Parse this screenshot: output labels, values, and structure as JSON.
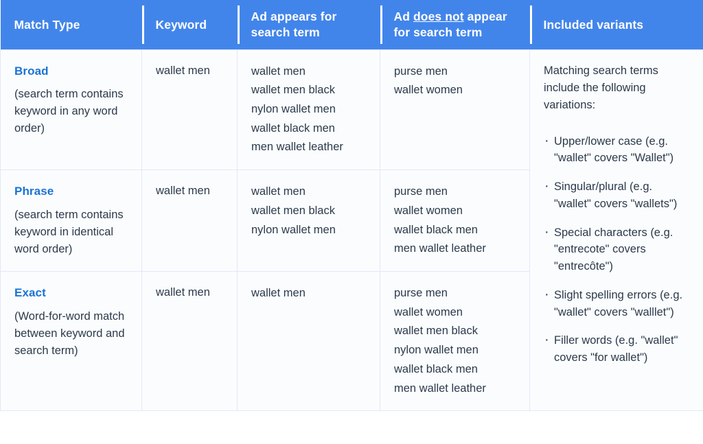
{
  "table": {
    "headers": [
      {
        "id": "match-type",
        "label": "Match Type"
      },
      {
        "id": "keyword",
        "label": "Keyword"
      },
      {
        "id": "ad-appears",
        "label": "Ad appears for search term"
      },
      {
        "id": "ad-does-not-appear",
        "label_before": "Ad ",
        "label_underlined": "does not",
        "label_after": " appear for search term"
      },
      {
        "id": "included-variants",
        "label": "Included variants"
      }
    ],
    "rows": [
      {
        "match_type_name": "Broad",
        "match_type_desc": "(search term contains keyword in any word order)",
        "keyword": "wallet men",
        "appears": [
          "wallet men",
          "wallet men black",
          "nylon wallet men",
          "wallet black men",
          "men wallet leather"
        ],
        "does_not_appear": [
          "purse men",
          "wallet women"
        ]
      },
      {
        "match_type_name": "Phrase",
        "match_type_desc": "(search term contains keyword in identical word order)",
        "keyword": "wallet men",
        "appears": [
          "wallet men",
          "wallet men black",
          "nylon wallet men"
        ],
        "does_not_appear": [
          "purse men",
          "wallet women",
          "wallet black men",
          "men wallet leather"
        ]
      },
      {
        "match_type_name": "Exact",
        "match_type_desc": "(Word-for-word match between keyword and search term)",
        "keyword": "wallet men",
        "appears": [
          "wallet men"
        ],
        "does_not_appear": [
          "purse men",
          "wallet women",
          "wallet men black",
          "nylon wallet men",
          "wallet black men",
          "men wallet leather"
        ]
      }
    ],
    "variants": {
      "intro": "Matching search terms include the following variations:",
      "items": [
        "Upper/lower case (e.g. \"wallet\" covers \"Wallet\")",
        "Singular/plural (e.g. \"wallet\" covers \"wallets\")",
        "Special characters (e.g. \"entrecote\" covers \"entrecôte\")",
        "Slight spelling errors (e.g. \"wallet\" covers \"walllet\")",
        "Filler words (e.g. \"wallet\" covers \"for wallet\")"
      ]
    }
  },
  "colors": {
    "header_background": "#4285ea",
    "header_text": "#ffffff",
    "match_type_accent": "#1a73d4",
    "body_text": "#2b3a4a",
    "cell_background": "#fbfcfe",
    "cell_border": "#e1e8f5"
  }
}
